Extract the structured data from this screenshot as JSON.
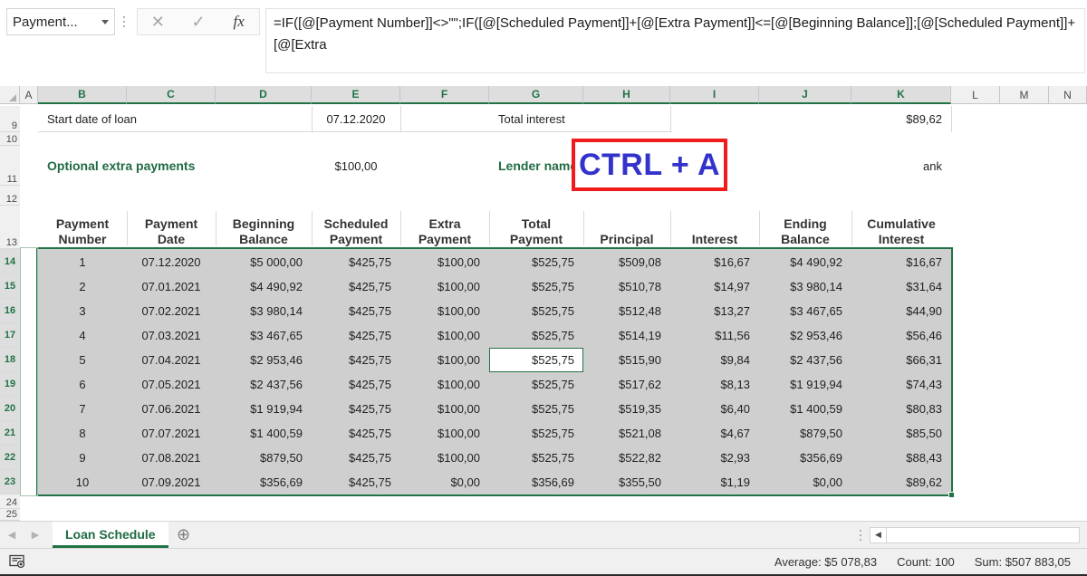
{
  "formula_bar": {
    "name_box_value": "Payment...",
    "cancel_icon": "close-icon",
    "confirm_icon": "check-icon",
    "function_icon": "fx-icon",
    "formula": "=IF([@[Payment Number]]<>\"\";IF([@[Scheduled Payment]]+[@[Extra Payment]]<=[@[Beginning Balance]];[@[Scheduled Payment]]+[@[Extra"
  },
  "columns": [
    {
      "letter": "A",
      "selected": false
    },
    {
      "letter": "B",
      "selected": true
    },
    {
      "letter": "C",
      "selected": true
    },
    {
      "letter": "D",
      "selected": true
    },
    {
      "letter": "E",
      "selected": true
    },
    {
      "letter": "F",
      "selected": true
    },
    {
      "letter": "G",
      "selected": true
    },
    {
      "letter": "H",
      "selected": true
    },
    {
      "letter": "I",
      "selected": true
    },
    {
      "letter": "J",
      "selected": true
    },
    {
      "letter": "K",
      "selected": true
    },
    {
      "letter": "L",
      "selected": false
    },
    {
      "letter": "M",
      "selected": false
    },
    {
      "letter": "N",
      "selected": false
    }
  ],
  "rows": [
    {
      "number": "9",
      "selected": false
    },
    {
      "number": "10",
      "selected": false
    },
    {
      "number": "11",
      "selected": false
    },
    {
      "number": "12",
      "selected": false
    },
    {
      "number": "13",
      "selected": false
    },
    {
      "number": "14",
      "selected": true
    },
    {
      "number": "15",
      "selected": true
    },
    {
      "number": "16",
      "selected": true
    },
    {
      "number": "17",
      "selected": true
    },
    {
      "number": "18",
      "selected": true
    },
    {
      "number": "19",
      "selected": true
    },
    {
      "number": "20",
      "selected": true
    },
    {
      "number": "21",
      "selected": true
    },
    {
      "number": "22",
      "selected": true
    },
    {
      "number": "23",
      "selected": true
    },
    {
      "number": "24",
      "selected": false
    },
    {
      "number": "25",
      "selected": false
    }
  ],
  "summary": {
    "start_date_label": "Start date of loan",
    "start_date_value": "07.12.2020",
    "total_interest_label": "Total interest",
    "total_interest_value": "$89,62",
    "extra_payments_label": "Optional extra payments",
    "extra_payments_value": "$100,00",
    "lender_name_label": "Lender name",
    "lender_name_value": "ank"
  },
  "annotation": {
    "shortcut_text": "CTRL + A"
  },
  "table": {
    "headers": [
      "Payment\nNumber",
      "Payment\nDate",
      "Beginning\nBalance",
      "Scheduled\nPayment",
      "Extra\nPayment",
      "Total\nPayment",
      "Principal",
      "Interest",
      "Ending\nBalance",
      "Cumulative\nInterest"
    ],
    "rows": [
      [
        "1",
        "07.12.2020",
        "$5 000,00",
        "$425,75",
        "$100,00",
        "$525,75",
        "$509,08",
        "$16,67",
        "$4 490,92",
        "$16,67"
      ],
      [
        "2",
        "07.01.2021",
        "$4 490,92",
        "$425,75",
        "$100,00",
        "$525,75",
        "$510,78",
        "$14,97",
        "$3 980,14",
        "$31,64"
      ],
      [
        "3",
        "07.02.2021",
        "$3 980,14",
        "$425,75",
        "$100,00",
        "$525,75",
        "$512,48",
        "$13,27",
        "$3 467,65",
        "$44,90"
      ],
      [
        "4",
        "07.03.2021",
        "$3 467,65",
        "$425,75",
        "$100,00",
        "$525,75",
        "$514,19",
        "$11,56",
        "$2 953,46",
        "$56,46"
      ],
      [
        "5",
        "07.04.2021",
        "$2 953,46",
        "$425,75",
        "$100,00",
        "$525,75",
        "$515,90",
        "$9,84",
        "$2 437,56",
        "$66,31"
      ],
      [
        "6",
        "07.05.2021",
        "$2 437,56",
        "$425,75",
        "$100,00",
        "$525,75",
        "$517,62",
        "$8,13",
        "$1 919,94",
        "$74,43"
      ],
      [
        "7",
        "07.06.2021",
        "$1 919,94",
        "$425,75",
        "$100,00",
        "$525,75",
        "$519,35",
        "$6,40",
        "$1 400,59",
        "$80,83"
      ],
      [
        "8",
        "07.07.2021",
        "$1 400,59",
        "$425,75",
        "$100,00",
        "$525,75",
        "$521,08",
        "$4,67",
        "$879,50",
        "$85,50"
      ],
      [
        "9",
        "07.08.2021",
        "$879,50",
        "$425,75",
        "$100,00",
        "$525,75",
        "$522,82",
        "$2,93",
        "$356,69",
        "$88,43"
      ],
      [
        "10",
        "07.09.2021",
        "$356,69",
        "$425,75",
        "$0,00",
        "$356,69",
        "$355,50",
        "$1,19",
        "$0,00",
        "$89,62"
      ]
    ],
    "active_cell": {
      "row_index": 4,
      "col_index": 5
    }
  },
  "sheet_tabs": {
    "prev_icon": "chevron-left-icon",
    "next_icon": "chevron-right-icon",
    "active_tab": "Loan Schedule",
    "add_sheet_icon": "plus-circle-icon"
  },
  "status_bar": {
    "macro_icon": "record-macro-icon",
    "average": "Average: $5 078,83",
    "count": "Count: 100",
    "sum": "Sum: $507 883,05"
  },
  "colors": {
    "excel_green": "#217346",
    "header_green": "#1f6b43",
    "annotation_red": "#f21b1b",
    "annotation_blue": "#3333cc",
    "selection_gray": "#cfcfcf"
  }
}
